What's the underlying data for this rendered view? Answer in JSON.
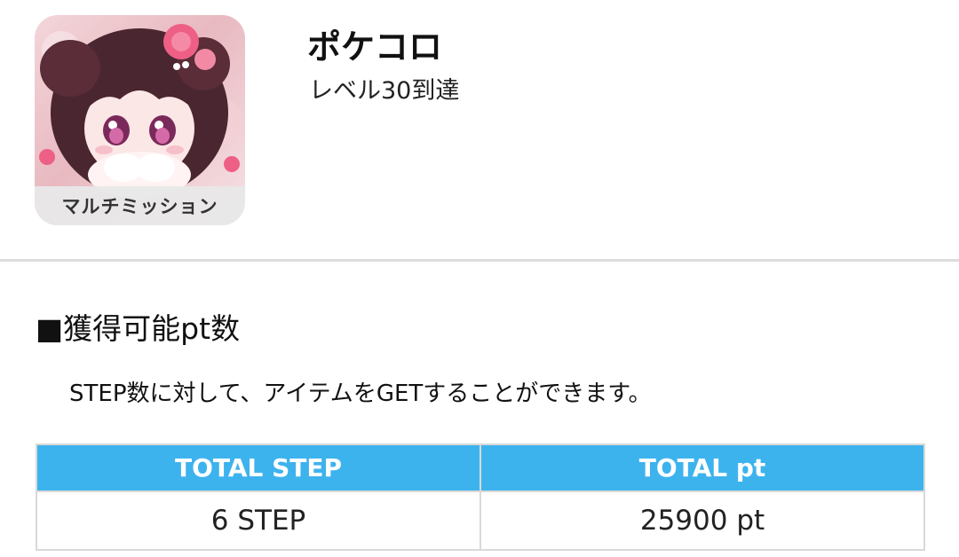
{
  "app": {
    "title": "ポケコロ",
    "subtitle": "レベル30到達",
    "badge": "マルチミッション",
    "icon": "game-app-icon"
  },
  "section": {
    "heading": "■獲得可能pt数",
    "description": "STEP数に対して、アイテムをGETすることができます。"
  },
  "table": {
    "headers": [
      "TOTAL STEP",
      "TOTAL pt"
    ],
    "rows": [
      [
        "6 STEP",
        "25900 pt"
      ]
    ]
  },
  "colors": {
    "table_header": "#3db3ee",
    "divider": "#dddddd"
  }
}
